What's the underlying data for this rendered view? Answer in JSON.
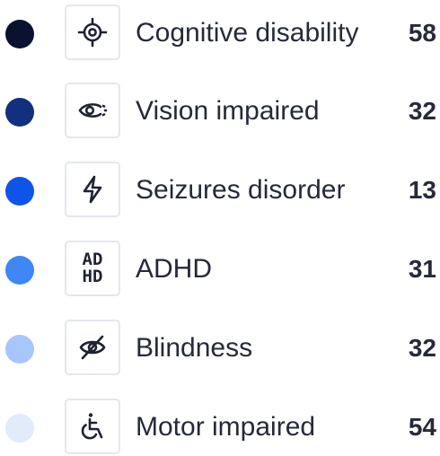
{
  "legend": {
    "items": [
      {
        "label": "Cognitive disability",
        "count": "58",
        "color": "#0b1230",
        "icon": "target-icon"
      },
      {
        "label": "Vision impaired",
        "count": "32",
        "color": "#11307e",
        "icon": "eye-icon"
      },
      {
        "label": "Seizures disorder",
        "count": "13",
        "color": "#0e54e8",
        "icon": "lightning-icon"
      },
      {
        "label": "ADHD",
        "count": "31",
        "color": "#3e87f5",
        "icon": "adhd-icon",
        "icon_text_top": "AD",
        "icon_text_bottom": "HD"
      },
      {
        "label": "Blindness",
        "count": "32",
        "color": "#a7c6fb",
        "icon": "eye-slash-icon"
      },
      {
        "label": "Motor impaired",
        "count": "54",
        "color": "#e1ebfc",
        "icon": "wheelchair-icon"
      }
    ]
  }
}
